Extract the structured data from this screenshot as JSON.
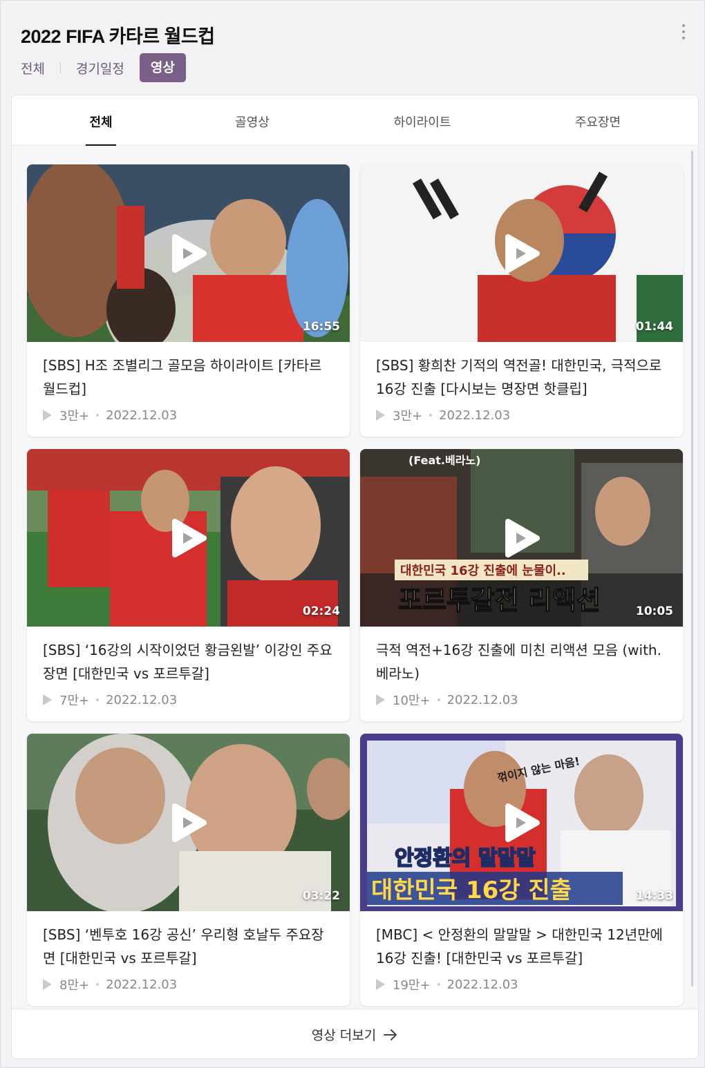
{
  "header": {
    "title": "2022 FIFA 카타르 월드컵",
    "more_icon": "more-vertical-icon"
  },
  "category_tabs": [
    {
      "label": "전체",
      "active": false
    },
    {
      "label": "경기일정",
      "active": false
    },
    {
      "label": "영상",
      "active": true
    }
  ],
  "sub_tabs": [
    {
      "label": "전체",
      "active": true
    },
    {
      "label": "골영상",
      "active": false
    },
    {
      "label": "하이라이트",
      "active": false
    },
    {
      "label": "주요장면",
      "active": false
    }
  ],
  "videos": [
    {
      "title": "[SBS] H조 조별리그 골모음 하이라이트 [카타르 월드컵]",
      "duration": "16:55",
      "views": "3만+",
      "date": "2022.12.03"
    },
    {
      "title": "[SBS] 황희찬 기적의 역전골! 대한민국, 극적으로 16강 진출 [다시보는 명장면 핫클립]",
      "duration": "01:44",
      "views": "3만+",
      "date": "2022.12.03"
    },
    {
      "title": "[SBS] ‘16강의 시작이었던 황금왼발’ 이강인 주요장면 [대한민국 vs 포르투갈]",
      "duration": "02:24",
      "views": "7만+",
      "date": "2022.12.03"
    },
    {
      "title": "극적 역전+16강 진출에 미친 리액션 모음 (with. 베라노)",
      "duration": "10:05",
      "views": "10만+",
      "date": "2022.12.03",
      "thumb_text": [
        "(Feat.베라노)",
        "대한민국 16강 진출에 눈물이..",
        "포르투갈전 리액션"
      ]
    },
    {
      "title": "[SBS] ‘벤투호 16강 공신’ 우리형 호날두 주요장면 [대한민국 vs 포르투갈]",
      "duration": "03:22",
      "views": "8만+",
      "date": "2022.12.03"
    },
    {
      "title": "[MBC] < 안정환의 말말말 > 대한민국 12년만에 16강 진출! [대한민국 vs 포르투갈]",
      "duration": "14:33",
      "views": "19만+",
      "date": "2022.12.03",
      "thumb_text": [
        "꺾이지 않는 마음!",
        "안정환의 말말말",
        "대한민국 16강 진출"
      ]
    }
  ],
  "more_videos": {
    "label": "영상 더보기",
    "icon": "arrow-right-icon"
  },
  "colors": {
    "accent": "#7a5f88",
    "tab_text": "#6b5a78"
  }
}
